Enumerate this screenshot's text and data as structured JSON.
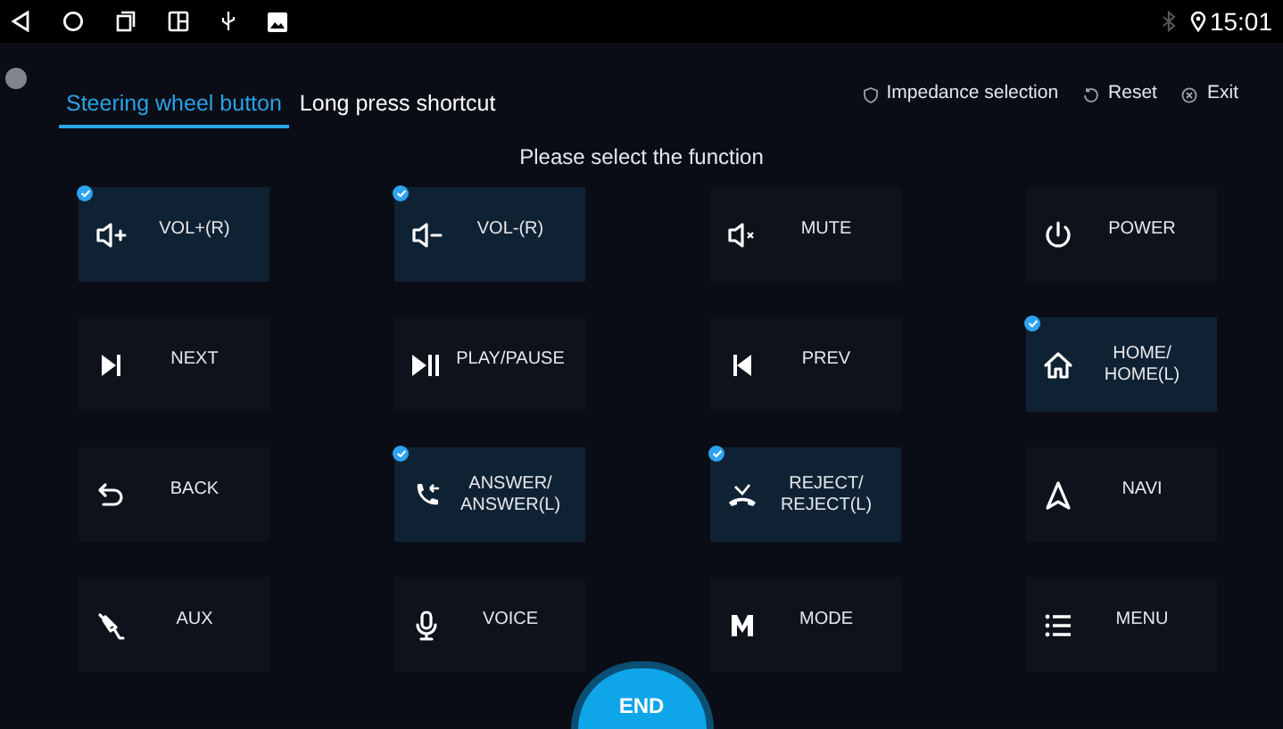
{
  "status_bar": {
    "time": "15:01"
  },
  "tabs": [
    {
      "label": "Steering wheel button",
      "selected": true
    },
    {
      "label": "Long press shortcut",
      "selected": false
    }
  ],
  "actions": [
    {
      "kind": "impedance",
      "label": "Impedance selection"
    },
    {
      "kind": "reset",
      "label": "Reset"
    },
    {
      "kind": "exit",
      "label": "Exit"
    }
  ],
  "prompt": "Please select the function",
  "functions": [
    {
      "kind": "vol-up",
      "label": "VOL+(R)",
      "selected": true
    },
    {
      "kind": "vol-down",
      "label": "VOL-(R)",
      "selected": true
    },
    {
      "kind": "mute",
      "label": "MUTE",
      "selected": false
    },
    {
      "kind": "power",
      "label": "POWER",
      "selected": false
    },
    {
      "kind": "next",
      "label": "NEXT",
      "selected": false
    },
    {
      "kind": "play",
      "label": "PLAY/PAUSE",
      "selected": false
    },
    {
      "kind": "prev",
      "label": "PREV",
      "selected": false
    },
    {
      "kind": "home",
      "label": "HOME/\nHOME(L)",
      "selected": true
    },
    {
      "kind": "back",
      "label": "BACK",
      "selected": false
    },
    {
      "kind": "answer",
      "label": "ANSWER/\nANSWER(L)",
      "selected": true
    },
    {
      "kind": "reject",
      "label": "REJECT/\nREJECT(L)",
      "selected": true
    },
    {
      "kind": "navi",
      "label": "NAVI",
      "selected": false
    },
    {
      "kind": "aux",
      "label": "AUX",
      "selected": false
    },
    {
      "kind": "voice",
      "label": "VOICE",
      "selected": false
    },
    {
      "kind": "mode",
      "label": "MODE",
      "selected": false
    },
    {
      "kind": "menu",
      "label": "MENU",
      "selected": false
    }
  ],
  "end_button": "END"
}
